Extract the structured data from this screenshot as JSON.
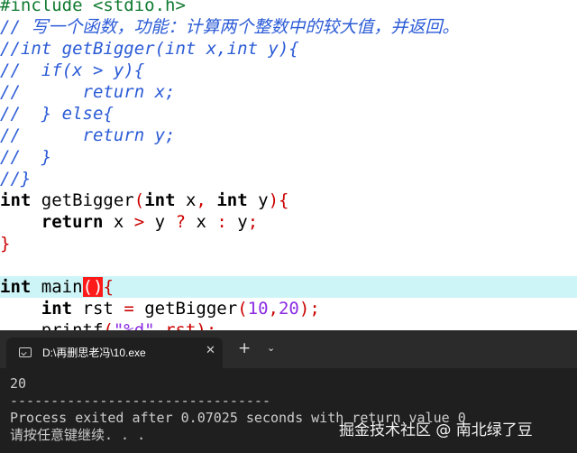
{
  "editor": {
    "line1": {
      "directive": "#include <stdio.h>"
    },
    "line2": {
      "comment": "// 写一个函数，功能：计算两个整数中的较大值，并返回。"
    },
    "line3": {
      "comment": "//int getBigger(int x,int y){"
    },
    "line4": {
      "comment": "//  if(x > y){"
    },
    "line5": {
      "comment": "//      return x;"
    },
    "line6": {
      "comment": "//  } else{"
    },
    "line7": {
      "comment": "//      return y;"
    },
    "line8": {
      "comment": "//  }"
    },
    "line9": {
      "comment": "//}"
    },
    "line10": {
      "kw_int1": "int",
      "fn_name": "getBigger",
      "paren_open": "(",
      "kw_int2": "int",
      "param_x": "x",
      "comma": ",",
      "kw_int3": "int",
      "param_y": "y",
      "paren_close": ")",
      "brace": "{"
    },
    "line11": {
      "kw_return": "return",
      "x": "x",
      "gt": ">",
      "y": "y",
      "q": "?",
      "x2": "x",
      "colon": ":",
      "y2": "y",
      "semi": ";"
    },
    "line12": {
      "brace": "}"
    },
    "line14": {
      "kw_int": "int",
      "fn_name": "main",
      "parens": "()",
      "brace": "{"
    },
    "line15": {
      "kw_int": "int",
      "var": "rst",
      "eq": "=",
      "call": "getBigger",
      "po": "(",
      "a": "10",
      "comma": ",",
      "b": "20",
      "pc": ")",
      "semi": ";"
    },
    "line16": {
      "fn": "printf",
      "po": "(",
      "fmt": "\"%d\"",
      "rest": ",rst);"
    }
  },
  "terminal": {
    "tab_title": "D:\\再删思老冯\\10.exe",
    "close_glyph": "✕",
    "new_tab_glyph": "+",
    "dropdown_glyph": "⌄",
    "output_value": "20",
    "separator": "--------------------------------",
    "exit_message": "Process exited after 0.07025 seconds with return value 0",
    "press_any_key": "请按任意键继续. . .",
    "watermark": "掘金技术社区 @ 南北绿了豆"
  },
  "colors": {
    "highlight_line": "#cdf4f6",
    "comment": "#2b5bd6",
    "preprocessor": "#0f7a2f",
    "operator": "#cc0000",
    "number": "#8a2be2",
    "terminal_bg": "#1f1f1f"
  }
}
